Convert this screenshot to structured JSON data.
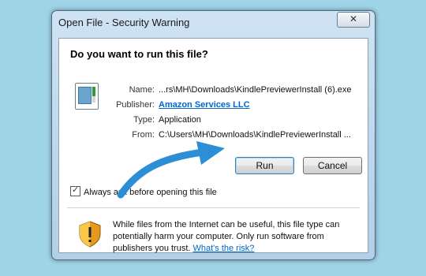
{
  "window": {
    "title": "Open File - Security Warning",
    "close_symbol": "✕"
  },
  "dialog": {
    "heading": "Do you want to run this file?",
    "icon": "application-file-icon",
    "fields": {
      "name_label": "Name:",
      "name_value": "...rs\\MH\\Downloads\\KindlePreviewerInstall (6).exe",
      "publisher_label": "Publisher:",
      "publisher_value": "Amazon Services LLC",
      "type_label": "Type:",
      "type_value": "Application",
      "from_label": "From:",
      "from_value": "C:\\Users\\MH\\Downloads\\KindlePreviewerInstall ..."
    },
    "buttons": {
      "run": "Run",
      "cancel": "Cancel"
    },
    "checkbox": {
      "label": "Always ask before opening this file",
      "checked": true
    },
    "warning": {
      "icon": "security-shield-icon",
      "text": "While files from the Internet can be useful, this file type can potentially harm your computer. Only run software from publishers you trust.",
      "link": "What's the risk?"
    }
  },
  "overlay": {
    "icon": "curved-arrow-icon",
    "color": "#2c8fd6"
  }
}
